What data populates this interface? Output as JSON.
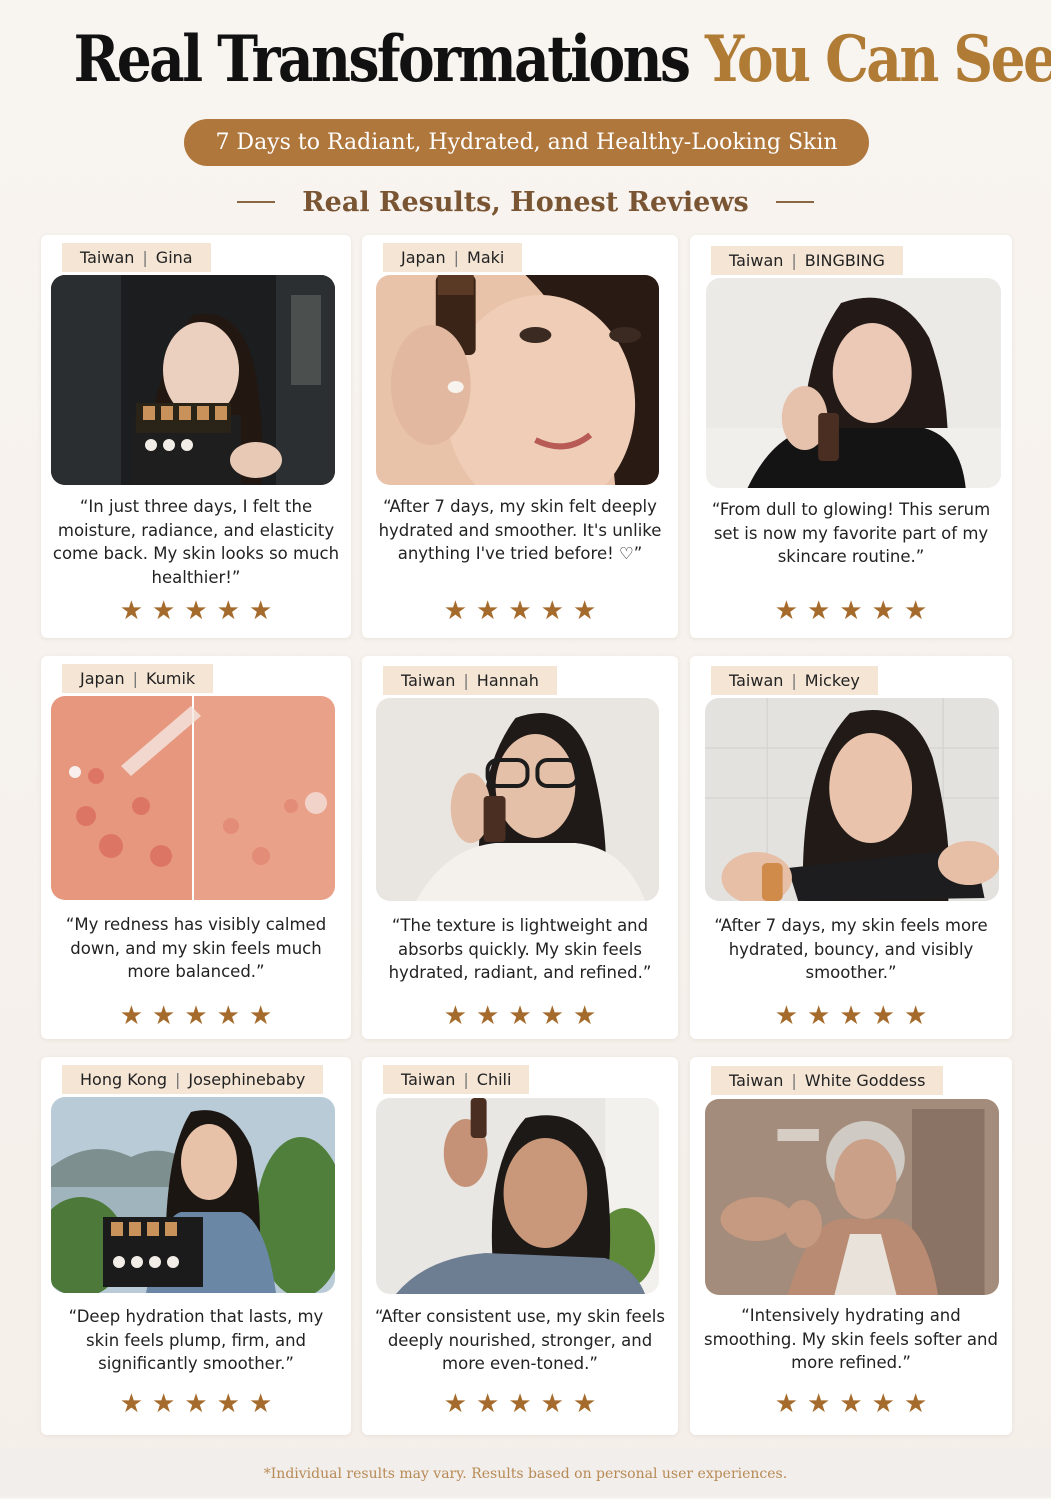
{
  "header": {
    "title_main": "Real Transformations",
    "title_accent": "You Can See",
    "tagline": "7 Days to Radiant, Hydrated, and Healthy-Looking Skin",
    "section_title": "Real Results, Honest Reviews"
  },
  "reviews": [
    {
      "country": "Taiwan",
      "name": "Gina",
      "photo": "woman holding serum gift box",
      "quote": "“In just three days, I felt the moisture, radiance, and elasticity come back. My skin looks so much healthier!”",
      "stars": "★★★★★",
      "rating": 5
    },
    {
      "country": "Japan",
      "name": "Maki",
      "photo": "woman applying serum dropper",
      "quote": "“After 7 days, my skin felt deeply hydrated and smoother. It's unlike anything I've tried before! ♡”",
      "stars": "★★★★★",
      "rating": 5
    },
    {
      "country": "Taiwan",
      "name": "BINGBING",
      "photo": "woman holding serum bottle",
      "quote": "“From dull to glowing! This serum set is now my favorite part of my skincare routine.”",
      "stars": "★★★★★",
      "rating": 5
    },
    {
      "country": "Japan",
      "name": "Kumik",
      "photo": "before and after skin close-up",
      "quote": "“My redness has visibly calmed down, and my skin feels much more balanced.”",
      "stars": "★★★★★",
      "rating": 5
    },
    {
      "country": "Taiwan",
      "name": "Hannah",
      "photo": "woman with glasses holding serum",
      "quote": "“The texture is lightweight and absorbs quickly. My skin feels hydrated, radiant, and refined.”",
      "stars": "★★★★★",
      "rating": 5
    },
    {
      "country": "Taiwan",
      "name": "Mickey",
      "photo": "woman holding product box",
      "quote": "“After 7 days, my skin feels more hydrated, bouncy, and visibly smoother.”",
      "stars": "★★★★★",
      "rating": 5
    },
    {
      "country": "Hong Kong",
      "name": "Josephinebaby",
      "photo": "woman holding serum set outdoors",
      "quote": "“Deep hydration that lasts, my skin feels plump, firm, and significantly smoother.”",
      "stars": "★★★★★",
      "rating": 5
    },
    {
      "country": "Taiwan",
      "name": "Chili",
      "photo": "woman holding serum bottle up",
      "quote": "“After consistent use, my skin feels deeply nourished, stronger, and more even-toned.”",
      "stars": "★★★★★",
      "rating": 5
    },
    {
      "country": "Taiwan",
      "name": "White Goddess",
      "photo": "gray-haired woman applying serum",
      "quote": "“Intensively hydrating and smoothing. My skin feels softer and more refined.”",
      "stars": "★★★★★",
      "rating": 5
    }
  ],
  "footer": {
    "disclaimer": "*Individual results may vary. Results based on personal user experiences."
  },
  "colors": {
    "accent": "#b0773d",
    "title_gold": "#b07b34",
    "star": "#a56b2c",
    "tag_bg": "#f4e5d5",
    "page_bg": "#f8f4f0"
  }
}
